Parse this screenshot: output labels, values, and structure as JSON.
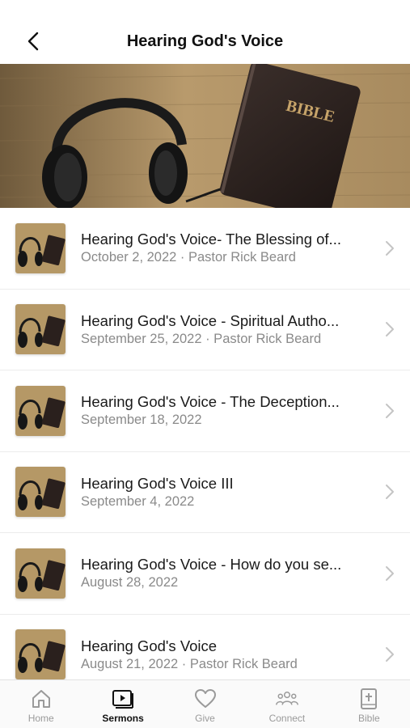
{
  "header": {
    "title": "Hearing God's Voice"
  },
  "hero": {
    "image": "headphones-and-bible",
    "book_text": "BIBLE"
  },
  "sermons": [
    {
      "title": "Hearing God's Voice- The Blessing of...",
      "subtitle": "October 2, 2022 · Pastor Rick Beard"
    },
    {
      "title": "Hearing God's Voice - Spiritual Autho...",
      "subtitle": "September 25, 2022 · Pastor Rick Beard"
    },
    {
      "title": "Hearing God's Voice - The Deception...",
      "subtitle": "September 18, 2022"
    },
    {
      "title": "Hearing God's Voice III",
      "subtitle": "September 4, 2022"
    },
    {
      "title": "Hearing God's Voice - How do you se...",
      "subtitle": "August 28, 2022"
    },
    {
      "title": "Hearing God's Voice",
      "subtitle": "August 21, 2022 · Pastor Rick Beard"
    }
  ],
  "tabbar": {
    "active": "Sermons",
    "tabs": [
      {
        "label": "Home",
        "icon": "home-icon"
      },
      {
        "label": "Sermons",
        "icon": "video-play-icon"
      },
      {
        "label": "Give",
        "icon": "heart-icon"
      },
      {
        "label": "Connect",
        "icon": "people-icon"
      },
      {
        "label": "Bible",
        "icon": "bible-icon"
      }
    ]
  },
  "colors": {
    "accent": "#111111",
    "inactive": "#9a9a9a",
    "subtitle": "#8a8a8a"
  }
}
